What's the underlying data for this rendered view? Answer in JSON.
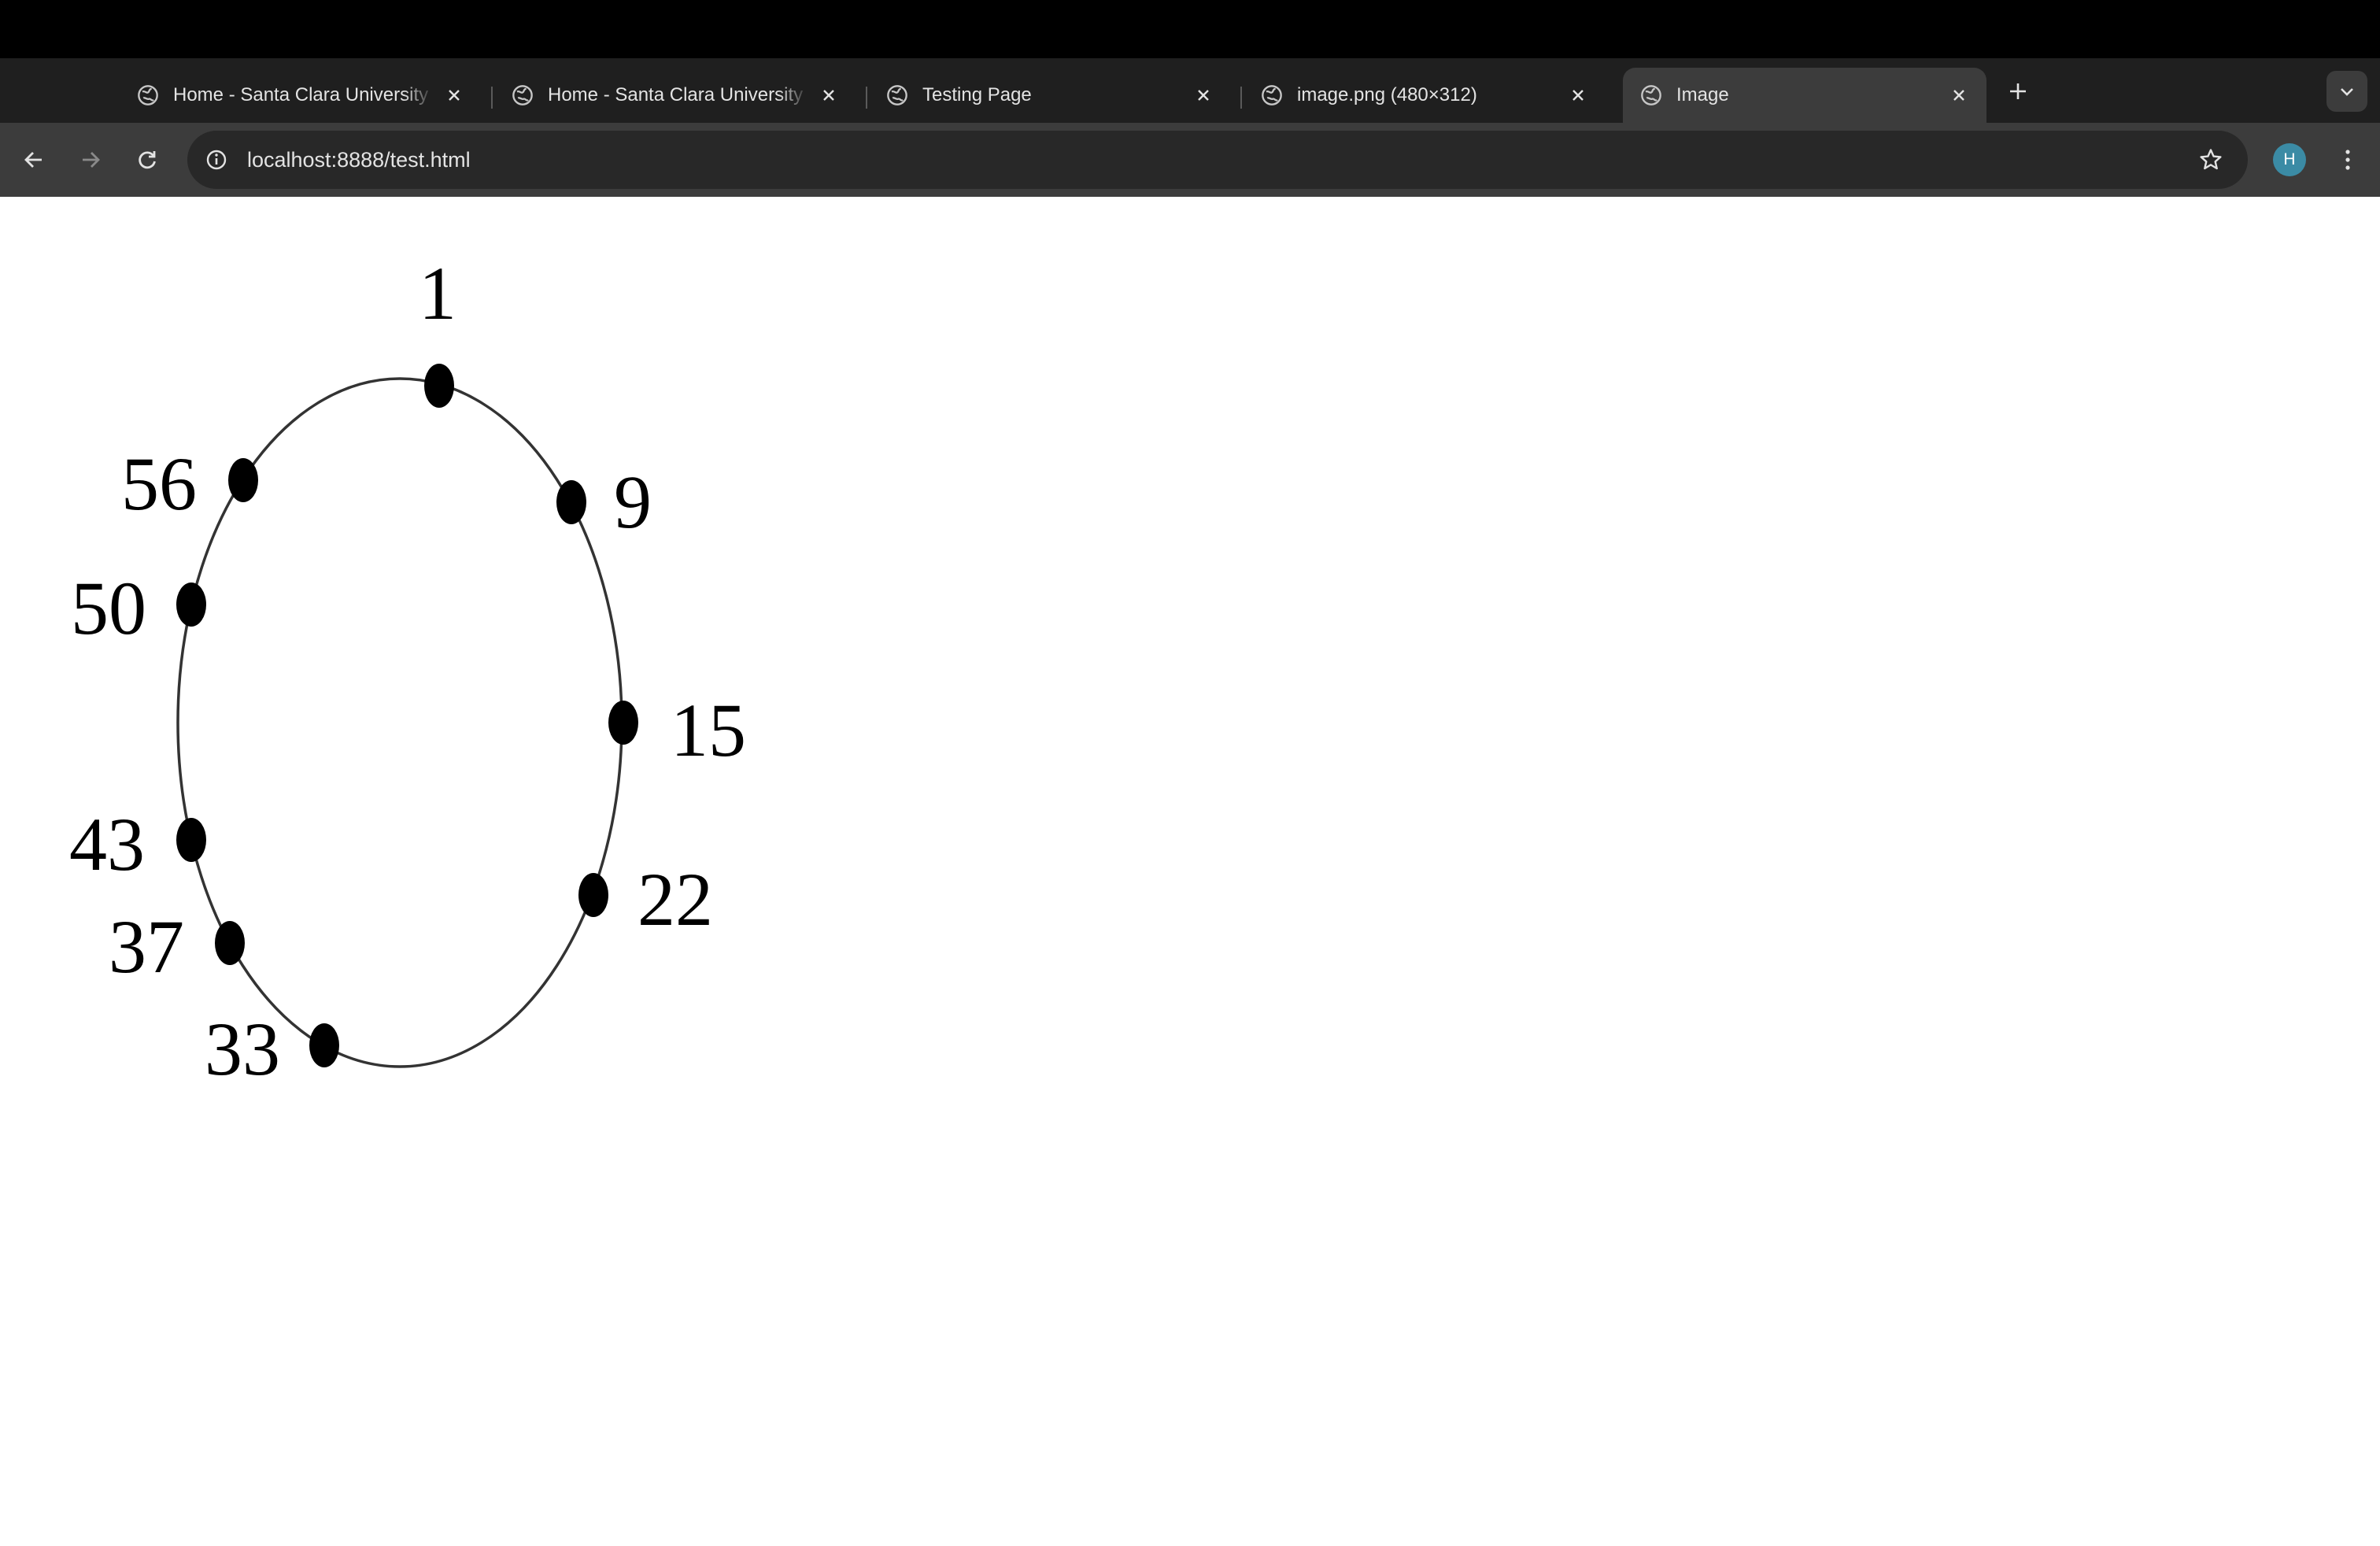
{
  "browser": {
    "tabs": [
      {
        "title": "Home - Santa Clara University",
        "active": false,
        "icon": "globe-icon"
      },
      {
        "title": "Home - Santa Clara University",
        "active": false,
        "icon": "globe-icon"
      },
      {
        "title": "Testing Page",
        "active": false,
        "icon": "globe-icon"
      },
      {
        "title": "image.png (480×312)",
        "active": false,
        "icon": "globe-icon"
      },
      {
        "title": "Image",
        "active": true,
        "icon": "globe-icon"
      }
    ],
    "address_bar": {
      "url": "localhost:8888/test.html"
    },
    "profile": {
      "initial": "H",
      "color": "#3b8ba5"
    }
  },
  "diagram": {
    "shape": "circle",
    "node_labels": [
      "1",
      "9",
      "15",
      "22",
      "33",
      "37",
      "43",
      "50",
      "56"
    ]
  }
}
